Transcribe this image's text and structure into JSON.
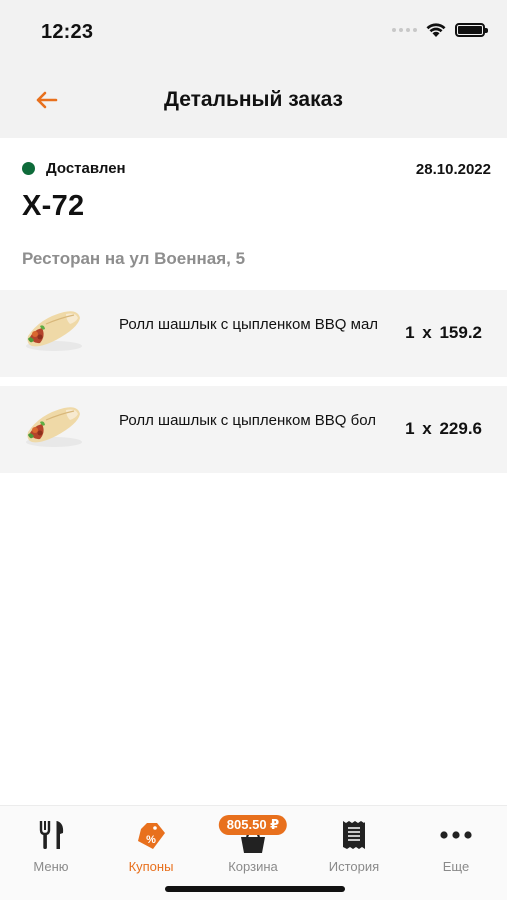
{
  "status_bar": {
    "time": "12:23"
  },
  "header": {
    "title": "Детальный заказ",
    "back_icon": "arrow-left-icon",
    "accent": "#e8701d"
  },
  "order": {
    "status": "Доставлен",
    "status_color": "#0e6b3a",
    "date": "28.10.2022",
    "number": "X-72",
    "restaurant": "Ресторан на ул Военная, 5"
  },
  "items": [
    {
      "name": "Ролл шашлык с цыпленком BBQ мал",
      "qty": "1 x 159.2",
      "image": "shawarma-roll-image"
    },
    {
      "name": "Ролл шашлык с цыпленком BBQ бол",
      "qty": "1 x 229.6",
      "image": "shawarma-roll-image"
    }
  ],
  "tabs": [
    {
      "label": "Меню",
      "icon": "fork-knife-icon",
      "active": false
    },
    {
      "label": "Купоны",
      "icon": "coupon-tag-icon",
      "active": true
    },
    {
      "label": "Корзина",
      "icon": "cart-icon",
      "badge": "805.50 ₽",
      "active": false
    },
    {
      "label": "История",
      "icon": "receipt-icon",
      "active": false
    },
    {
      "label": "Еще",
      "icon": "more-dots-icon",
      "active": false
    }
  ]
}
